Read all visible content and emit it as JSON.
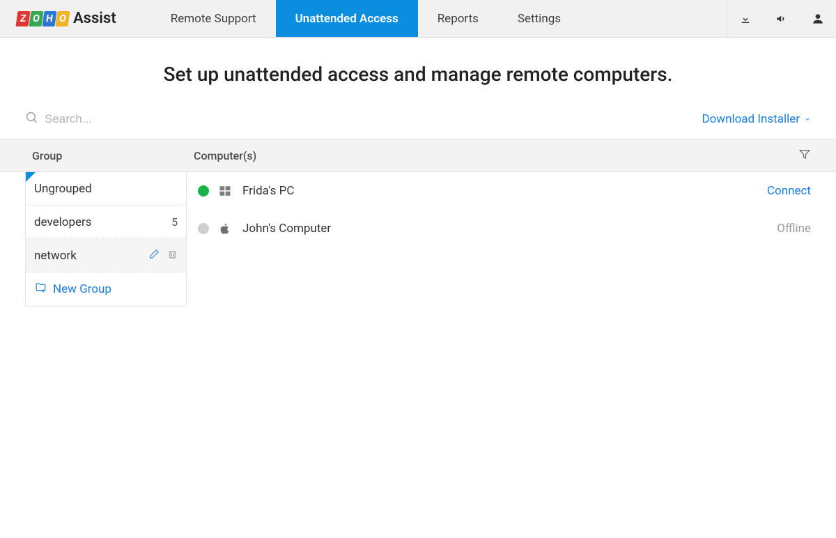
{
  "brand": {
    "assist": "Assist"
  },
  "nav": {
    "remote_support": "Remote Support",
    "unattended_access": "Unattended Access",
    "reports": "Reports",
    "settings": "Settings"
  },
  "page_title": "Set up unattended access and manage remote computers.",
  "search": {
    "placeholder": "Search..."
  },
  "download_link": "Download Installer",
  "headers": {
    "group": "Group",
    "computers": "Computer(s)"
  },
  "groups": [
    {
      "name": "Ungrouped",
      "count": ""
    },
    {
      "name": "developers",
      "count": "5"
    },
    {
      "name": "network",
      "count": ""
    }
  ],
  "new_group": "New Group",
  "computers": [
    {
      "name": "Frida's PC",
      "os": "windows",
      "status": "online",
      "action": "Connect"
    },
    {
      "name": "John's Computer",
      "os": "apple",
      "status": "offline",
      "action": "Offline"
    }
  ]
}
